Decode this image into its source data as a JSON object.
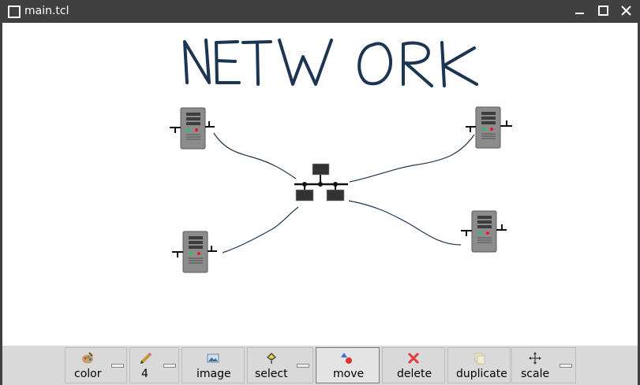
{
  "window": {
    "title": "main.tcl",
    "controls": [
      "minimize-icon",
      "maximize-icon",
      "close-icon"
    ]
  },
  "canvas": {
    "handwritten_text": "NETWORK",
    "stroke_color": "#1c3553",
    "objects": [
      {
        "name": "server-icon-top-left",
        "type": "server"
      },
      {
        "name": "server-icon-top-right",
        "type": "server"
      },
      {
        "name": "server-icon-bottom-left",
        "type": "server"
      },
      {
        "name": "server-icon-bottom-right",
        "type": "server"
      },
      {
        "name": "network-hub-icon",
        "type": "network"
      }
    ]
  },
  "toolbar": {
    "color_label": "color",
    "width_label": "4",
    "image_label": "image",
    "select_label": "select",
    "move_label": "move",
    "delete_label": "delete",
    "duplicate_label": "duplicate",
    "scale_label": "scale",
    "active_tool": "move"
  },
  "colors": {
    "titlebar": "#404040",
    "toolbar": "#d9d9d9",
    "server_body": "#8c8c8c",
    "led_green": "#22c55e",
    "led_red": "#e11d1d"
  }
}
